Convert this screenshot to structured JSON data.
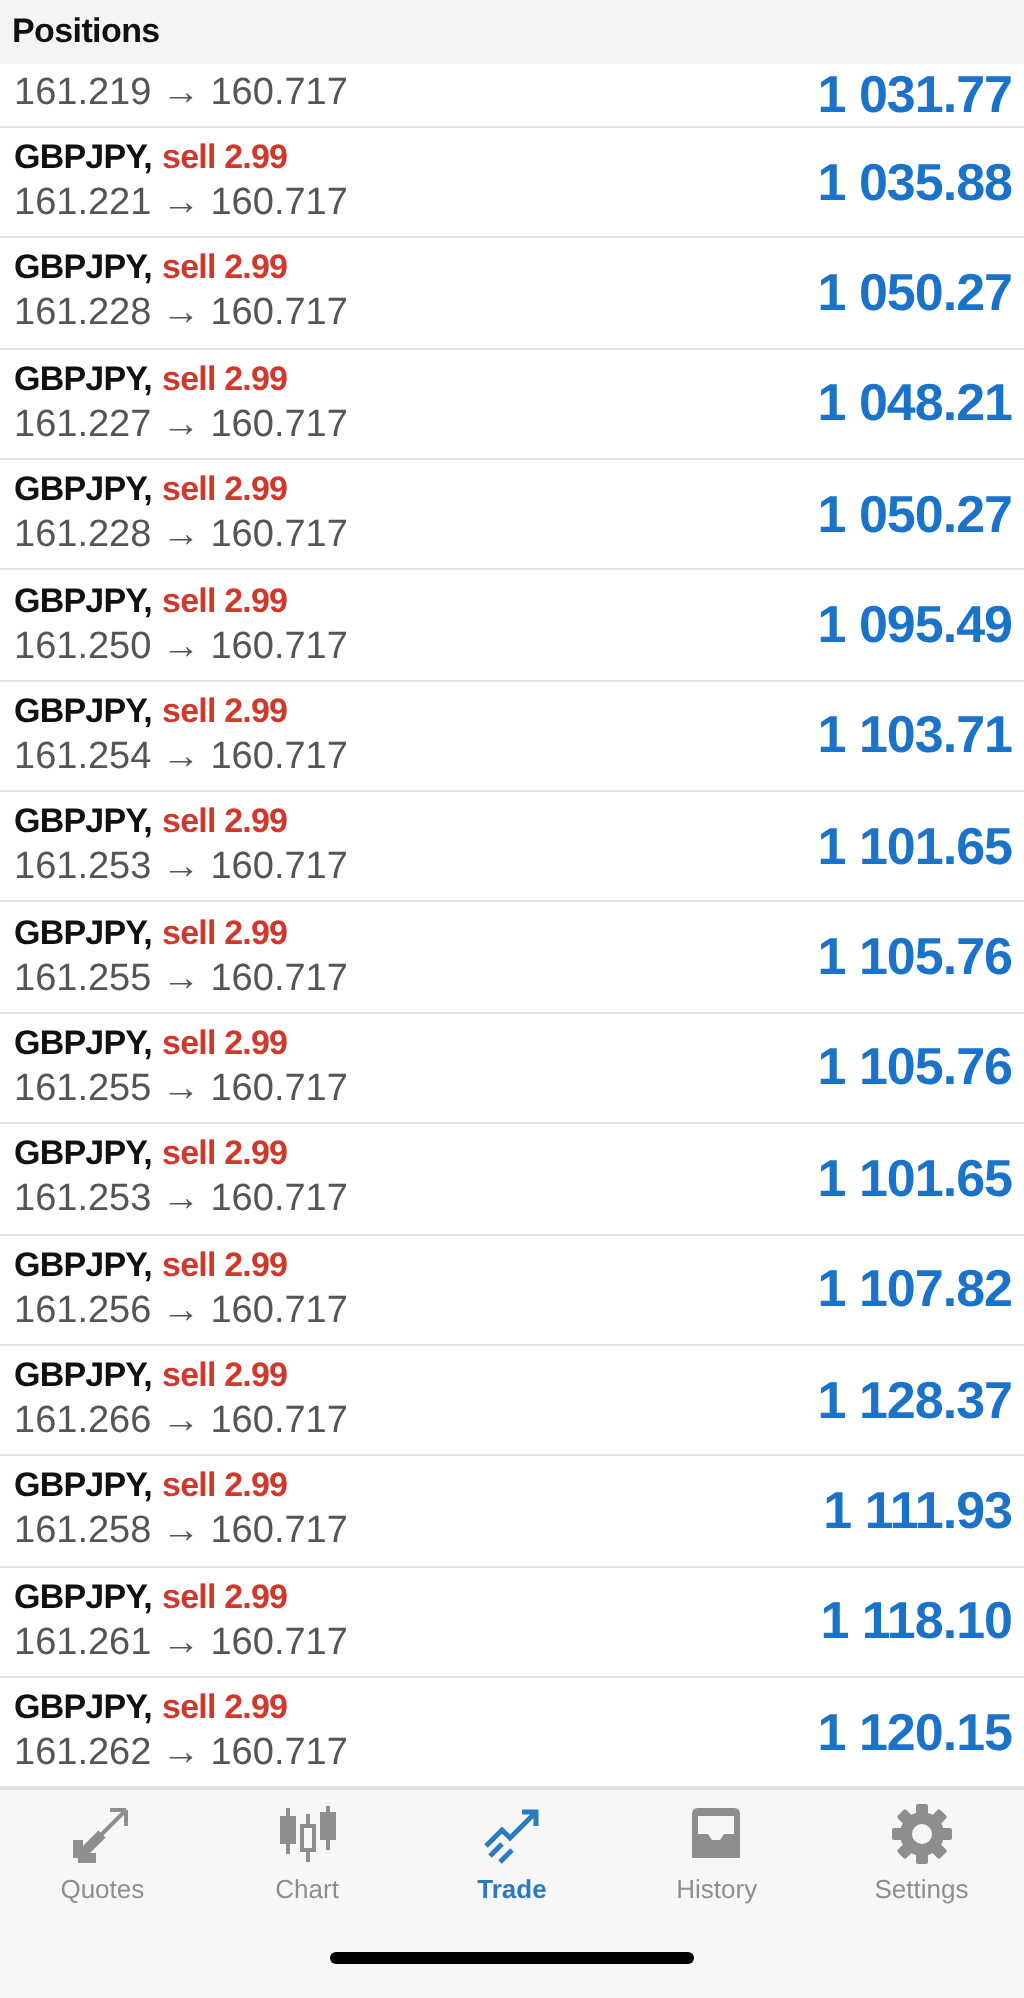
{
  "header": {
    "title": "Positions"
  },
  "partial_row": {
    "prices": "161.219 → 160.717",
    "profit": "1 031.77"
  },
  "positions": [
    {
      "symbol": "GBPJPY,",
      "order": "sell 2.99",
      "prices": "161.221 → 160.717",
      "profit": "1 035.88"
    },
    {
      "symbol": "GBPJPY,",
      "order": "sell 2.99",
      "prices": "161.228 → 160.717",
      "profit": "1 050.27"
    },
    {
      "symbol": "GBPJPY,",
      "order": "sell 2.99",
      "prices": "161.227 → 160.717",
      "profit": "1 048.21"
    },
    {
      "symbol": "GBPJPY,",
      "order": "sell 2.99",
      "prices": "161.228 → 160.717",
      "profit": "1 050.27"
    },
    {
      "symbol": "GBPJPY,",
      "order": "sell 2.99",
      "prices": "161.250 → 160.717",
      "profit": "1 095.49"
    },
    {
      "symbol": "GBPJPY,",
      "order": "sell 2.99",
      "prices": "161.254 → 160.717",
      "profit": "1 103.71"
    },
    {
      "symbol": "GBPJPY,",
      "order": "sell 2.99",
      "prices": "161.253 → 160.717",
      "profit": "1 101.65"
    },
    {
      "symbol": "GBPJPY,",
      "order": "sell 2.99",
      "prices": "161.255 → 160.717",
      "profit": "1 105.76"
    },
    {
      "symbol": "GBPJPY,",
      "order": "sell 2.99",
      "prices": "161.255 → 160.717",
      "profit": "1 105.76"
    },
    {
      "symbol": "GBPJPY,",
      "order": "sell 2.99",
      "prices": "161.253 → 160.717",
      "profit": "1 101.65"
    },
    {
      "symbol": "GBPJPY,",
      "order": "sell 2.99",
      "prices": "161.256 → 160.717",
      "profit": "1 107.82"
    },
    {
      "symbol": "GBPJPY,",
      "order": "sell 2.99",
      "prices": "161.266 → 160.717",
      "profit": "1 128.37"
    },
    {
      "symbol": "GBPJPY,",
      "order": "sell 2.99",
      "prices": "161.258 → 160.717",
      "profit": "1 111.93"
    },
    {
      "symbol": "GBPJPY,",
      "order": "sell 2.99",
      "prices": "161.261 → 160.717",
      "profit": "1 118.10"
    },
    {
      "symbol": "GBPJPY,",
      "order": "sell 2.99",
      "prices": "161.262 → 160.717",
      "profit": "1 120.15"
    }
  ],
  "tabs": [
    {
      "kind": "quotes",
      "label": "Quotes",
      "selected": false
    },
    {
      "kind": "chart",
      "label": "Chart",
      "selected": false
    },
    {
      "kind": "trade",
      "label": "Trade",
      "selected": true
    },
    {
      "kind": "history",
      "label": "History",
      "selected": false
    },
    {
      "kind": "settings",
      "label": "Settings",
      "selected": false
    }
  ]
}
